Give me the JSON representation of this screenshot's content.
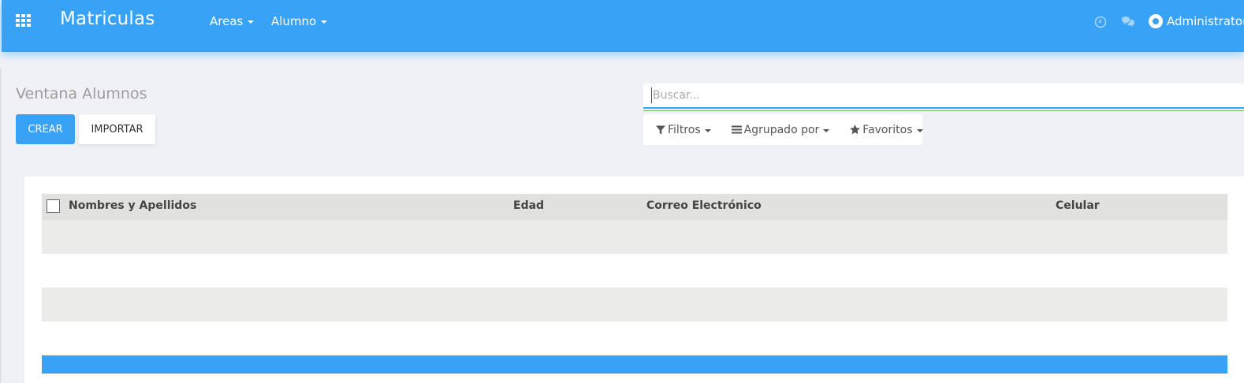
{
  "navbar": {
    "app_title": "Matriculas",
    "menus": [
      {
        "label": "Areas"
      },
      {
        "label": "Alumno"
      }
    ],
    "user_name": "Administrator",
    "icons": [
      "apps-grid-icon",
      "clock-icon",
      "chat-icon",
      "avatar-icon"
    ]
  },
  "page": {
    "title": "Ventana Alumnos",
    "create_label": "CREAR",
    "import_label": "IMPORTAR"
  },
  "search": {
    "placeholder": "Buscar..."
  },
  "filters": {
    "filters_label": "Filtros",
    "group_label": "Agrupado por",
    "favorites_label": "Favoritos"
  },
  "table": {
    "columns": [
      "Nombres y Apellidos",
      "Edad",
      "Correo Electrónico",
      "Celular"
    ]
  },
  "colors": {
    "brand": "#38a2f7",
    "row_alt": "#ebecea",
    "header_bg": "#e1e1df"
  }
}
